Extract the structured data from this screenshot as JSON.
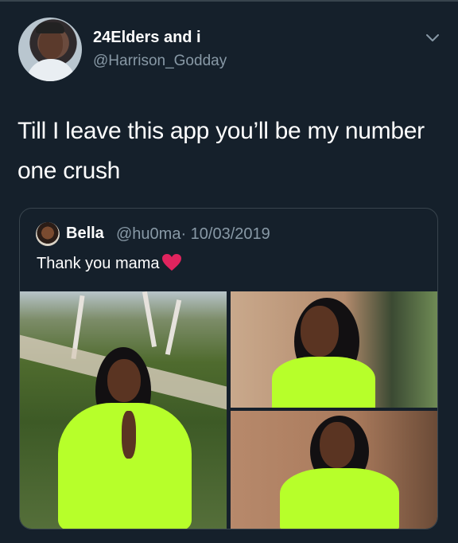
{
  "tweet": {
    "author_name": "24Elders and i",
    "author_handle": "@Harrison_Godday",
    "text": "Till I leave this app you’ll be my number one crush"
  },
  "quoted_tweet": {
    "author_name": "Bella",
    "author_handle": "@hu0ma",
    "date": "· 10/03/2019",
    "text": "Thank you mama"
  },
  "icons": {
    "menu": "chevron-down-icon",
    "reaction": "red-heart-icon"
  },
  "colors": {
    "background": "#15202b",
    "secondary_text": "#8899a6",
    "border": "#38444d",
    "heart": "#e0245e"
  }
}
